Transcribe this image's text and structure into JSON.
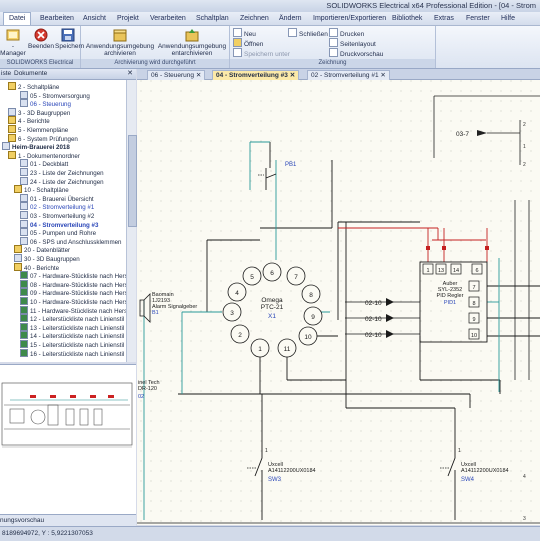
{
  "app": {
    "title": "SOLIDWORKS Electrical x64 Professional Edition - [04 - Strom"
  },
  "menu": [
    "Datei",
    "Bearbeiten",
    "Ansicht",
    "Projekt",
    "Verarbeiten",
    "Schaltplan",
    "Zeichnen",
    "Ändern",
    "Importieren/Exportieren",
    "Bibliothek",
    "Extras",
    "Fenster",
    "Hilfe"
  ],
  "ribbon": {
    "group1": {
      "buttons": [
        "-Manager",
        "Beenden",
        "Speichern"
      ],
      "caption": "SOLIDWORKS Electrical"
    },
    "group2": {
      "buttons": [
        "Anwendungsumgebung archivieren",
        "Anwendungsumgebung entarchivieren"
      ],
      "caption": "Archivierung wird durchgeführt"
    },
    "group3": {
      "left": [
        "Neu",
        "Öffnen",
        "Speichern unter"
      ],
      "mid": [
        "Schließen"
      ],
      "right": [
        "Drucken",
        "Seitenlayout",
        "Druckvorschau"
      ],
      "caption": "Zeichnung"
    }
  },
  "panel": {
    "title": "Dokumente",
    "prefix": "iste"
  },
  "tabs": [
    "06 - Steuerung",
    "04 - Stromverteilung #3",
    "02 - Stromverteilung #1"
  ],
  "tree": [
    {
      "t": "2 - Schaltpläne"
    },
    {
      "t": "05 - Stromversorgung"
    },
    {
      "t": "06 - Steuerung"
    },
    {
      "t": "3 - 3D Baugruppen"
    },
    {
      "t": "4 - Berichte"
    },
    {
      "t": "5 - Klemmenpläne"
    },
    {
      "t": "6 - System Prüfungen"
    },
    {
      "t": "Heim-Brauerei 2018"
    },
    {
      "t": "1 - Dokumentenordner"
    },
    {
      "t": "01 - Deckblatt"
    },
    {
      "t": "23 - Liste der Zeichnungen"
    },
    {
      "t": "24 - Liste der Zeichnungen"
    },
    {
      "t": "10 - Schaltpläne"
    },
    {
      "t": "01 - Brauerei Übersicht"
    },
    {
      "t": "02 - Stromverteilung #1"
    },
    {
      "t": "03 - Stromverteilung #2"
    },
    {
      "t": "04 - Stromverteilung #3"
    },
    {
      "t": "05 - Pumpen und Rohre"
    },
    {
      "t": "06 - SPS und Anschlussklemmen"
    },
    {
      "t": "20 - Datenblätter"
    },
    {
      "t": "30 - 3D Baugruppen"
    },
    {
      "t": "40 - Berichte"
    },
    {
      "t": "07 - Hardware-Stückliste nach Hersteller"
    },
    {
      "t": "08 - Hardware-Stückliste nach Hersteller"
    },
    {
      "t": "09 - Hardware-Stückliste nach Hersteller"
    },
    {
      "t": "10 - Hardware-Stückliste nach Hersteller"
    },
    {
      "t": "11 - Hardware-Stückliste nach Hersteller"
    },
    {
      "t": "12 - Leiterstückliste nach Linienstil"
    },
    {
      "t": "13 - Leiterstückliste nach Linienstil"
    },
    {
      "t": "14 - Leiterstückliste nach Linienstil"
    },
    {
      "t": "15 - Leiterstückliste nach Linienstil"
    },
    {
      "t": "16 - Leiterstückliste nach Linienstil"
    }
  ],
  "preview": {
    "caption": "nungsvorschau"
  },
  "status": {
    "coords": "8189694972, Y : 5,9221307053"
  },
  "schematic": {
    "pb1": "PB1",
    "omega_title": "Omega",
    "omega_model": "PTC-21",
    "omega_tag": "X1",
    "pins": [
      "6",
      "7",
      "8",
      "9",
      "10",
      "11",
      "1",
      "2",
      "3",
      "4",
      "5"
    ],
    "baomain": [
      "Baomain",
      "1J2193",
      "Alarm Signalgeber",
      "B1"
    ],
    "auber": [
      "Auber",
      "SYL-2352",
      "PID Regler",
      "PID1"
    ],
    "auber_pins": [
      "1",
      "13",
      "14",
      "6",
      "7",
      "8",
      "9",
      "10"
    ],
    "refs": [
      "02-10",
      "02-10",
      "02-10"
    ],
    "ref_37": "03-7",
    "sw3": [
      "Uxcell",
      "A14112200UX0184",
      "SW3"
    ],
    "sw4": [
      "Uxcell",
      "A14112200UX0184",
      "SW4"
    ],
    "left_cut": [
      "inel Tech",
      "DR-120",
      "02"
    ],
    "small_labels": [
      "2",
      "1",
      "2",
      "1",
      "4",
      "3"
    ]
  }
}
